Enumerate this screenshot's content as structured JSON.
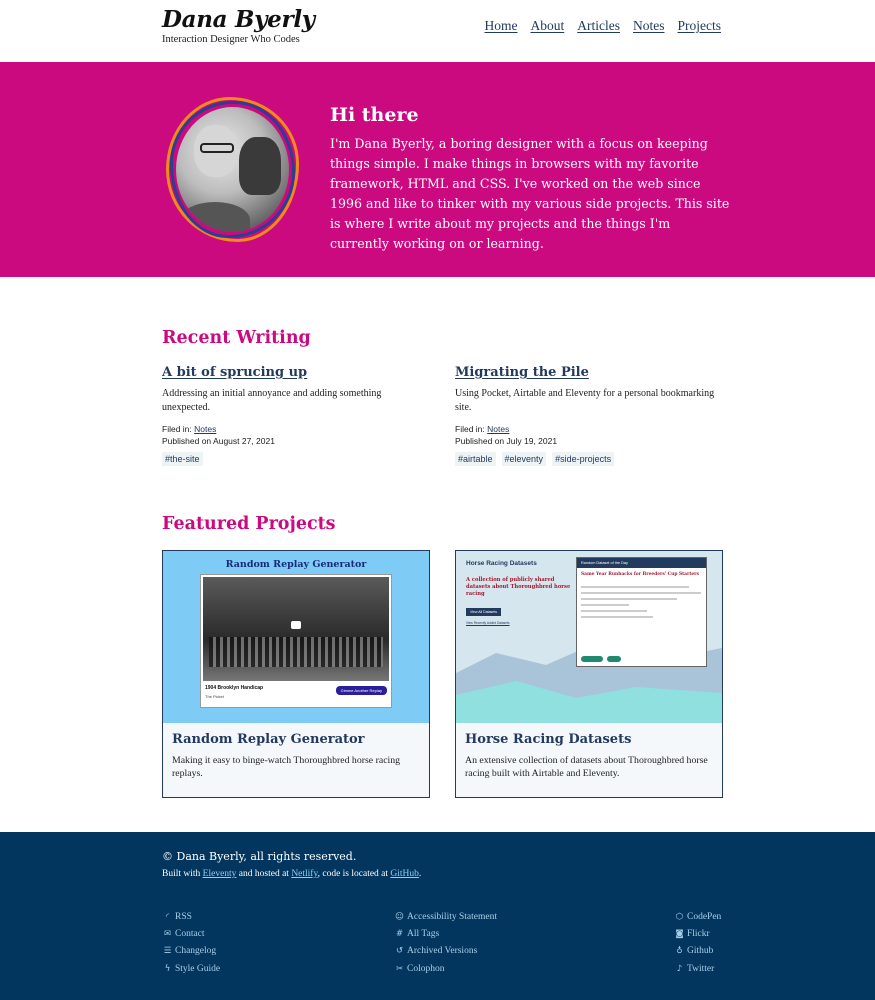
{
  "header": {
    "name": "Dana Byerly",
    "tagline": "Interaction Designer Who Codes",
    "nav": [
      "Home",
      "About",
      "Articles",
      "Notes",
      "Projects"
    ]
  },
  "hero": {
    "title": "Hi there",
    "text": "I'm Dana Byerly, a boring designer with a focus on keeping things simple. I make things in browsers with my favorite framework, HTML and CSS. I've worked on the web since 1996 and like to tinker with my various side projects. This site is where I write about my projects and the things I'm currently working on or learning."
  },
  "recent": {
    "title": "Recent Writing",
    "posts": [
      {
        "title": "A bit of sprucing up",
        "summary": "Addressing an initial annoyance and adding something unexpected.",
        "filed_label": "Filed in:",
        "filed_in": "Notes",
        "published": "Published on August 27, 2021",
        "tags": [
          "#the-site"
        ]
      },
      {
        "title": "Migrating the Pile",
        "summary": "Using Pocket, Airtable and Eleventy for a personal bookmarking site.",
        "filed_label": "Filed in:",
        "filed_in": "Notes",
        "published": "Published on July 19, 2021",
        "tags": [
          "#airtable",
          "#eleventy",
          "#side-projects"
        ]
      }
    ]
  },
  "projects": {
    "title": "Featured Projects",
    "items": [
      {
        "title": "Random Replay Generator",
        "desc": "Making it easy to binge-watch Thoroughbred horse racing replays.",
        "shot": {
          "heading": "Random Replay Generator",
          "caption": "1904 Brooklyn Handicap",
          "sub": "The Picket",
          "button": "Gimme Another Replay"
        }
      },
      {
        "title": "Horse Racing Datasets",
        "desc": "An extensive collection of datasets about Thoroughbred horse racing built with Airtable and Eleventy.",
        "shot": {
          "heading": "Horse Racing Datasets",
          "sub": "A collection of publicly shared datasets about Thoroughbred horse racing",
          "button": "View All Datasets",
          "link": "View Recently Added Datasets",
          "panel_head": "Random Dataset of the Day",
          "panel_title": "Same Year Runbacks for Breeders' Cup Starters"
        }
      }
    ]
  },
  "footer": {
    "copyright": "© Dana Byerly, all rights reserved.",
    "built_prefix": "Built with",
    "built_eleventy": "Eleventy",
    "built_mid": "and hosted at",
    "built_netlify": "Netlify",
    "built_mid2": ", code is located at",
    "built_github": "GitHub",
    "built_end": ".",
    "col1": [
      {
        "label": "RSS",
        "icon": "rss-icon"
      },
      {
        "label": "Contact",
        "icon": "mail-icon"
      },
      {
        "label": "Changelog",
        "icon": "list-icon"
      },
      {
        "label": "Style Guide",
        "icon": "bolt-icon"
      }
    ],
    "col2": [
      {
        "label": "Accessibility Statement",
        "icon": "accessibility-icon"
      },
      {
        "label": "All Tags",
        "icon": "hash-icon"
      },
      {
        "label": "Archived Versions",
        "icon": "history-icon"
      },
      {
        "label": "Colophon",
        "icon": "tools-icon"
      }
    ],
    "col3": [
      {
        "label": "CodePen",
        "icon": "codepen-icon"
      },
      {
        "label": "Flickr",
        "icon": "camera-icon"
      },
      {
        "label": "Github",
        "icon": "github-icon"
      },
      {
        "label": "Twitter",
        "icon": "twitter-icon"
      }
    ]
  },
  "colors": {
    "accent": "#cc0a80",
    "navy": "#02365f",
    "link": "#223a5e"
  }
}
